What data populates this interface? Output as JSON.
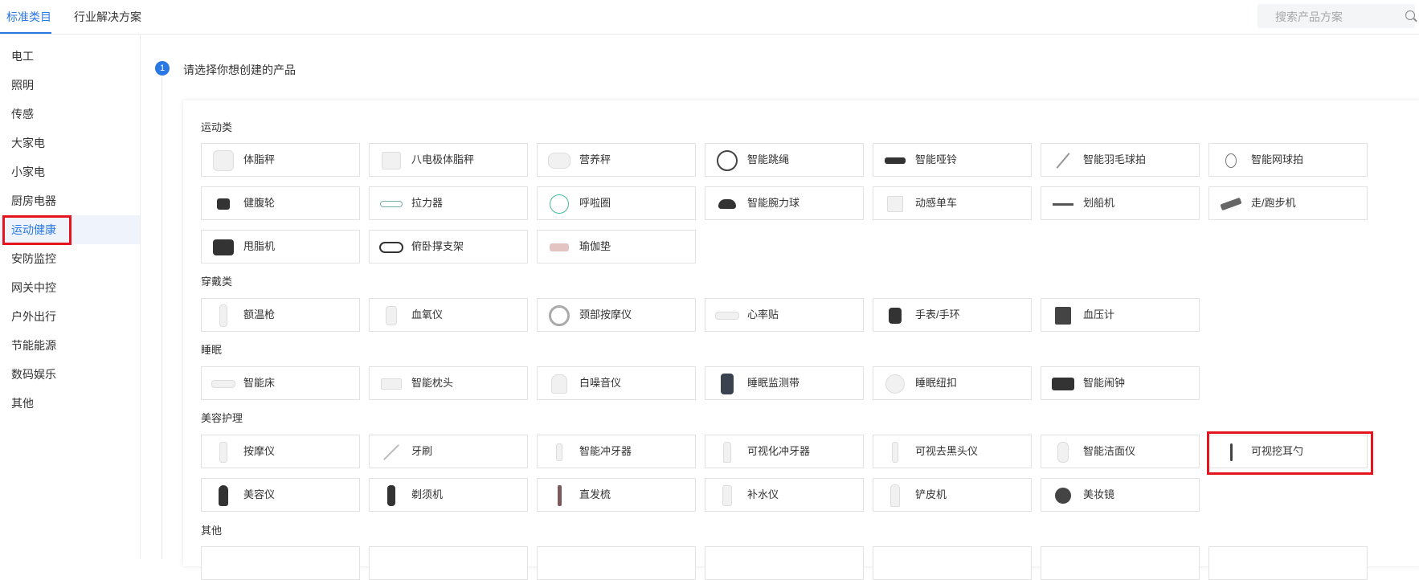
{
  "header": {
    "tabs": [
      {
        "label": "标准类目",
        "active": true
      },
      {
        "label": "行业解决方案",
        "active": false
      }
    ],
    "search": {
      "placeholder": "搜索产品方案",
      "icon": "search-icon"
    }
  },
  "sidebar": {
    "items": [
      "电工",
      "照明",
      "传感",
      "大家电",
      "小家电",
      "厨房电器",
      "运动健康",
      "安防监控",
      "网关中控",
      "户外出行",
      "节能能源",
      "数码娱乐",
      "其他"
    ],
    "active_index": 6
  },
  "step": {
    "number": "1",
    "title": "请选择你想创建的产品"
  },
  "categories": [
    {
      "title": "运动类",
      "products": [
        "体脂秤",
        "八电极体脂秤",
        "营养秤",
        "智能跳绳",
        "智能哑铃",
        "智能羽毛球拍",
        "智能网球拍",
        "健腹轮",
        "拉力器",
        "呼啦圈",
        "智能腕力球",
        "动感单车",
        "划船机",
        "走/跑步机",
        "甩脂机",
        "俯卧撑支架",
        "瑜伽垫"
      ]
    },
    {
      "title": "穿戴类",
      "products": [
        "额温枪",
        "血氧仪",
        "颈部按摩仪",
        "心率贴",
        "手表/手环",
        "血压计"
      ]
    },
    {
      "title": "睡眠",
      "products": [
        "智能床",
        "智能枕头",
        "白噪音仪",
        "睡眠监测带",
        "睡眠纽扣",
        "智能闹钟"
      ]
    },
    {
      "title": "美容护理",
      "products": [
        "按摩仪",
        "牙刷",
        "智能冲牙器",
        "可视化冲牙器",
        "可视去黑头仪",
        "智能洁面仪",
        "可视挖耳勺",
        "美容仪",
        "剃须机",
        "直发梳",
        "补水仪",
        "铲皮机",
        "美妆镜"
      ]
    },
    {
      "title": "其他",
      "products": []
    }
  ],
  "colors": {
    "accent": "#2a78e4",
    "highlight": "#e5141e"
  }
}
